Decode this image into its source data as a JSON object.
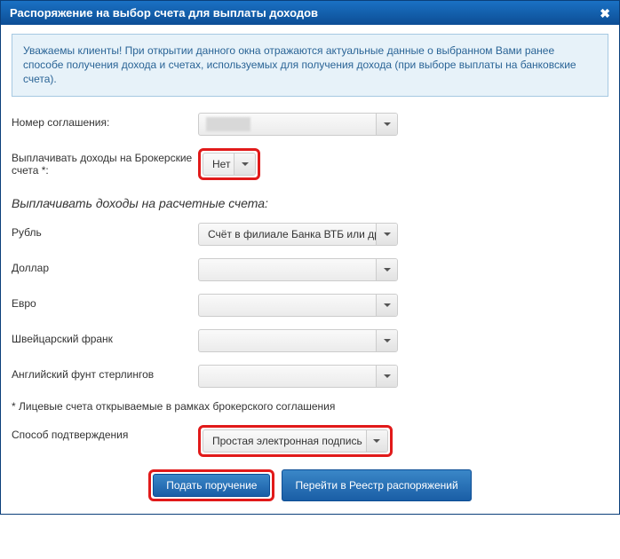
{
  "header": {
    "title": "Распоряжение на выбор счета для выплаты доходов"
  },
  "info": "Уважаемы клиенты! При открытии данного окна отражаются актуальные данные о выбранном Вами ранее способе получения дохода и счетах, используемых для получения дохода (при выборе выплаты на банковские счета).",
  "fields": {
    "agreementLabel": "Номер соглашения:",
    "agreementValue": "",
    "brokerLabel": "Выплачивать доходы на Брокерские счета *:",
    "brokerValue": "Нет"
  },
  "sectionTitle": "Выплачивать доходы на расчетные счета:",
  "currencies": {
    "rubLabel": "Рубль",
    "rubValue": "Счёт в филиале Банка ВТБ или другом",
    "usdLabel": "Доллар",
    "usdValue": "",
    "eurLabel": "Евро",
    "eurValue": "",
    "chfLabel": "Швейцарский франк",
    "chfValue": "",
    "gbpLabel": "Английский фунт стерлингов",
    "gbpValue": ""
  },
  "footnote": "* Лицевые счета открываемые в рамках брокерского соглашения",
  "confirm": {
    "label": "Способ подтверждения",
    "value": "Простая электронная подпись"
  },
  "buttons": {
    "submit": "Подать поручение",
    "goto": "Перейти в Реестр распоряжений"
  }
}
